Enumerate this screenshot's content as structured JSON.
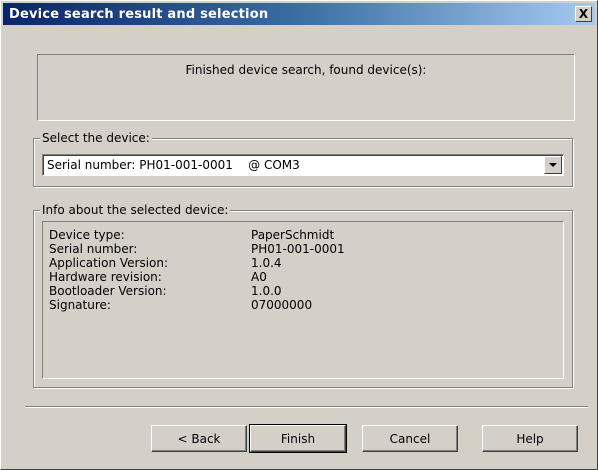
{
  "window": {
    "title": "Device search result and selection",
    "close_label": "X"
  },
  "status": {
    "text": "Finished device search, found device(s):"
  },
  "select_group": {
    "legend": "Select the device:",
    "selected_value": "Serial number: PH01-001-0001    @ COM3",
    "arrow_icon": "chevron-down-icon"
  },
  "info_group": {
    "legend": "Info about the selected device:",
    "rows": [
      {
        "label": "Device type:",
        "value": "PaperSchmidt"
      },
      {
        "label": "Serial number:",
        "value": "PH01-001-0001"
      },
      {
        "label": "Application Version:",
        "value": "1.0.4"
      },
      {
        "label": "Hardware revision:",
        "value": "A0"
      },
      {
        "label": "Bootloader Version:",
        "value": "1.0.0"
      },
      {
        "label": "Signature:",
        "value": "07000000"
      }
    ]
  },
  "buttons": {
    "back": "< Back",
    "finish": "Finish",
    "cancel": "Cancel",
    "help": "Help"
  },
  "colors": {
    "titlebar_start": "#0a246a",
    "titlebar_end": "#a6caf0",
    "face": "#d4d0c8"
  }
}
